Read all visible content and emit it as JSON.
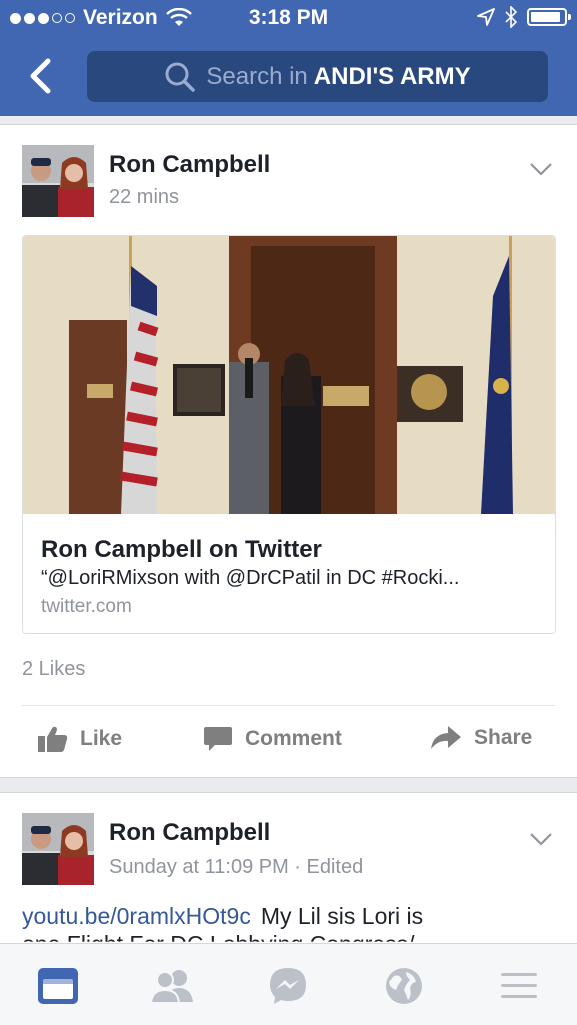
{
  "status": {
    "carrier": "Verizon",
    "time": "3:18 PM",
    "battery_level": 0.9
  },
  "header": {
    "search_prefix": "Search in",
    "search_group": "ANDI'S ARMY"
  },
  "post1": {
    "author": "Ron Campbell",
    "time": "22 mins",
    "link": {
      "title": "Ron Campbell on Twitter",
      "description": "“@LoriRMixson with @DrCPatil in DC #Rocki...",
      "domain": "twitter.com"
    },
    "likes": "2 Likes",
    "actions": {
      "like": "Like",
      "comment": "Comment",
      "share": "Share"
    }
  },
  "post2": {
    "author": "Ron Campbell",
    "time": "Sunday at 11:09 PM · Edited",
    "link_text": "youtu.be/0ramlxHOt9c",
    "text": "My Lil sis Lori is",
    "text_line2": "one Flight For DC Lobbying Congress/"
  },
  "tabs": [
    "news-feed-icon",
    "friends-icon",
    "messenger-icon",
    "globe-icon",
    "menu-icon"
  ],
  "colors": {
    "brand": "#4267b2",
    "search_bg": "#29487d",
    "link": "#365899",
    "active_tab": "#4267b2",
    "inactive_tab": "#bcc0c8"
  }
}
